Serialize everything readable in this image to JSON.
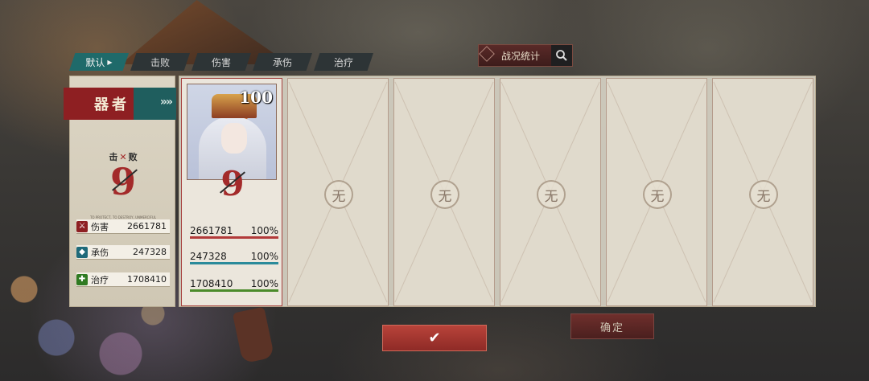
{
  "tabs": [
    {
      "label": "默认",
      "active": true
    },
    {
      "label": "击败",
      "active": false
    },
    {
      "label": "伤害",
      "active": false
    },
    {
      "label": "承伤",
      "active": false
    },
    {
      "label": "治疗",
      "active": false
    }
  ],
  "stats_button": {
    "label": "战况统计",
    "icon": "search-icon"
  },
  "summary": {
    "name": "器者",
    "kill_label_left": "击",
    "kill_label_right": "败",
    "kills": "9",
    "tiny_caption": "TO PROTECT, TO DESTROY, UNMERCIFUL",
    "rows": [
      {
        "icon": "sword-icon",
        "label": "伤害",
        "value": "2661781",
        "color": "#b02a2a"
      },
      {
        "icon": "shield-icon",
        "label": "承伤",
        "value": "247328",
        "color": "#1f7a8a"
      },
      {
        "icon": "heal-cross-icon",
        "label": "治疗",
        "value": "1708410",
        "color": "#3a8a2a"
      }
    ]
  },
  "cards": [
    {
      "filled": true,
      "level": "100",
      "kills": "9",
      "stats": [
        {
          "value": "2661781",
          "percent": "100%",
          "color": "#b23a3a"
        },
        {
          "value": "247328",
          "percent": "100%",
          "color": "#2a8a9a"
        },
        {
          "value": "1708410",
          "percent": "100%",
          "color": "#4a8a2a"
        }
      ]
    },
    {
      "filled": false,
      "empty_label": "无"
    },
    {
      "filled": false,
      "empty_label": "无"
    },
    {
      "filled": false,
      "empty_label": "无"
    },
    {
      "filled": false,
      "empty_label": "无"
    },
    {
      "filled": false,
      "empty_label": "无"
    }
  ],
  "buttons": {
    "confirm_icon": "✔",
    "ok_label": "确定"
  }
}
